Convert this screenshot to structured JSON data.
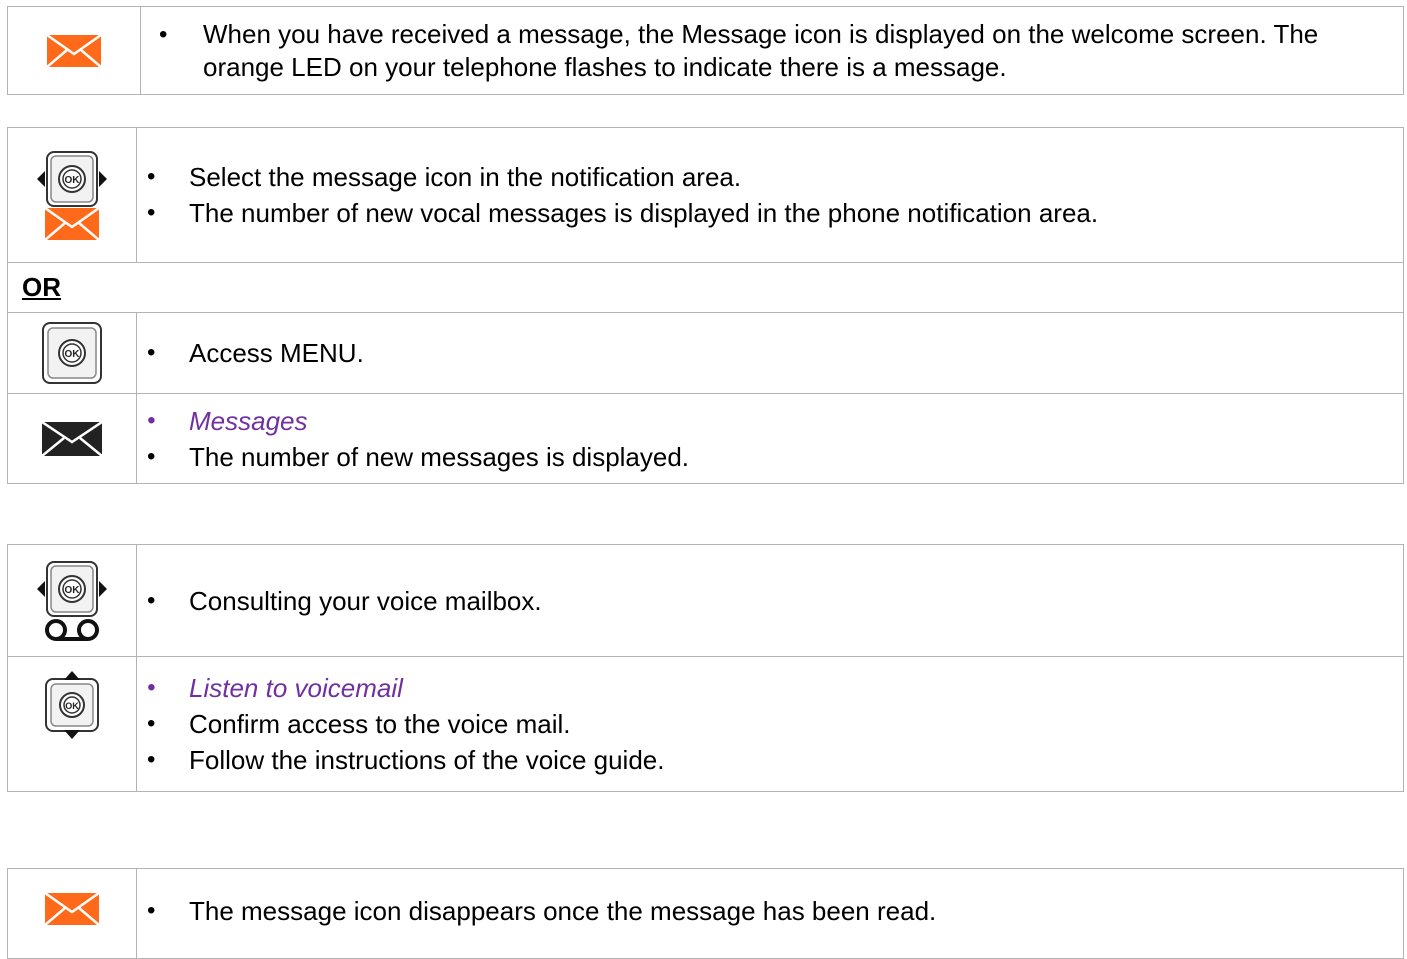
{
  "block1": {
    "icon": "orange-envelope-icon",
    "text": "When you have received a message, the Message icon is displayed on the welcome screen. The orange LED on your telephone flashes to indicate there is a message."
  },
  "block2": {
    "row1": {
      "icons": [
        "ok-left-right-navigator-icon",
        "orange-envelope-icon"
      ],
      "bullets": [
        "Select the message icon in the notification area.",
        "The number of new vocal messages is displayed in the phone notification area."
      ]
    },
    "or_label": "OR",
    "row2": {
      "icon": "ok-button-icon",
      "bullets": [
        "Access MENU."
      ]
    },
    "row3": {
      "icon": "black-envelope-icon",
      "bullets": [
        "Messages",
        "The number of new messages is displayed."
      ]
    }
  },
  "block3": {
    "row1": {
      "icons": [
        "ok-left-right-navigator-icon",
        "voicemail-icon"
      ],
      "bullets": [
        "Consulting your voice mailbox."
      ]
    },
    "row2": {
      "icon": "ok-up-down-navigator-icon",
      "bullets": [
        "Listen to voicemail",
        "Confirm access to the voice mail.",
        "Follow the instructions of the voice guide."
      ]
    }
  },
  "block4": {
    "icon": "orange-envelope-icon",
    "bullets": [
      "The message icon disappears once the message has been read."
    ]
  },
  "colors": {
    "orange": "#ff6a1a",
    "purple": "#7030a0",
    "border": "#b3b3b3"
  }
}
